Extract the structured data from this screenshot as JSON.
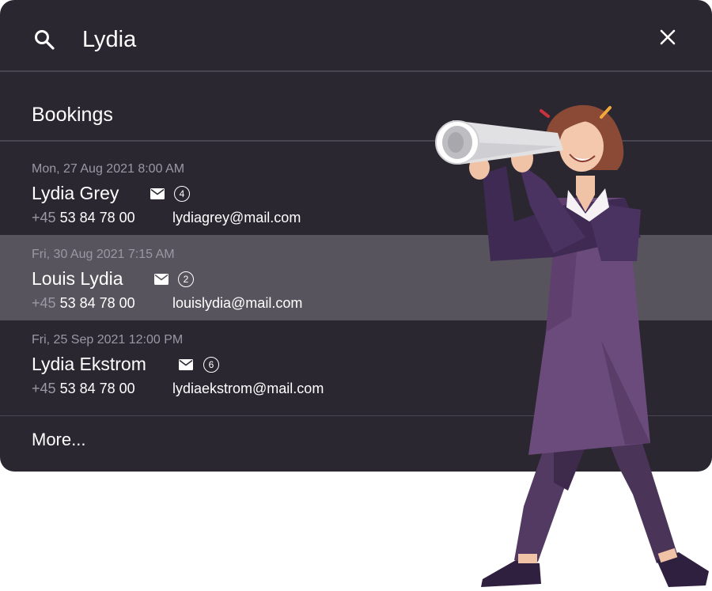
{
  "search": {
    "query": "Lydia",
    "icon": "search-icon",
    "close_icon": "close-icon"
  },
  "section": {
    "title": "Bookings"
  },
  "results": [
    {
      "date": "Mon, 27 Aug 2021 8:00 AM",
      "name": "Lydia Grey",
      "count": "4",
      "phone_cc": "+45",
      "phone": "53 84 78 00",
      "email": "lydiagrey@mail.com"
    },
    {
      "date": "Fri, 30 Aug 2021 7:15 AM",
      "name": "Louis Lydia",
      "count": "2",
      "phone_cc": "+45",
      "phone": "53 84 78 00",
      "email": "louislydia@mail.com"
    },
    {
      "date": "Fri, 25 Sep 2021 12:00 PM",
      "name": "Lydia Ekstrom",
      "count": "6",
      "phone_cc": "+45",
      "phone": "53 84 78 00",
      "email": "lydiaekstrom@mail.com"
    }
  ],
  "more_label": "More...",
  "colors": {
    "panel_bg": "#2a2731",
    "selected_row_bg": "#58545d",
    "muted_text": "#9c98a3",
    "divider": "#4a4651",
    "accent_purple": "#5e3f6e"
  }
}
